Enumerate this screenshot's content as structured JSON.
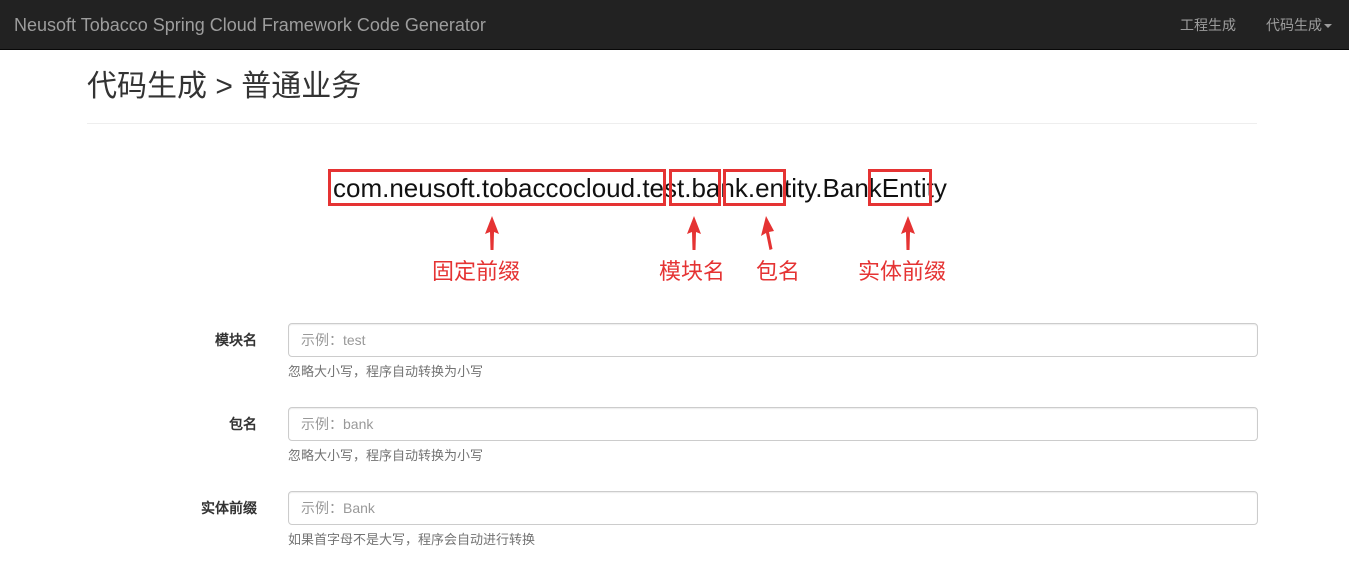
{
  "navbar": {
    "brand": "Neusoft Tobacco Spring Cloud Framework Code Generator",
    "items": [
      {
        "label": "工程生成"
      },
      {
        "label": "代码生成"
      }
    ]
  },
  "page": {
    "title": "代码生成 > 普通业务"
  },
  "diagram": {
    "segments": [
      {
        "text": "com.neusoft.tobaccocloud"
      },
      {
        "text": "."
      },
      {
        "text": "test"
      },
      {
        "text": "."
      },
      {
        "text": "bank"
      },
      {
        "text": ".entity."
      },
      {
        "text": "Bank"
      },
      {
        "text": "Entity"
      }
    ],
    "annotations": [
      {
        "label": "固定前缀"
      },
      {
        "label": "模块名"
      },
      {
        "label": "包名"
      },
      {
        "label": "实体前缀"
      }
    ],
    "highlight_color": "#e53333"
  },
  "form": {
    "fields": [
      {
        "label": "模块名",
        "value": "",
        "placeholder": "示例：test",
        "help": "忽略大小写，程序自动转换为小写"
      },
      {
        "label": "包名",
        "value": "",
        "placeholder": "示例：bank",
        "help": "忽略大小写，程序自动转换为小写"
      },
      {
        "label": "实体前缀",
        "value": "",
        "placeholder": "示例：Bank",
        "help": "如果首字母不是大写，程序会自动进行转换"
      }
    ]
  },
  "colors": {
    "navbar_bg": "#222222",
    "navbar_text": "#9d9d9d",
    "accent_red": "#e53333"
  }
}
